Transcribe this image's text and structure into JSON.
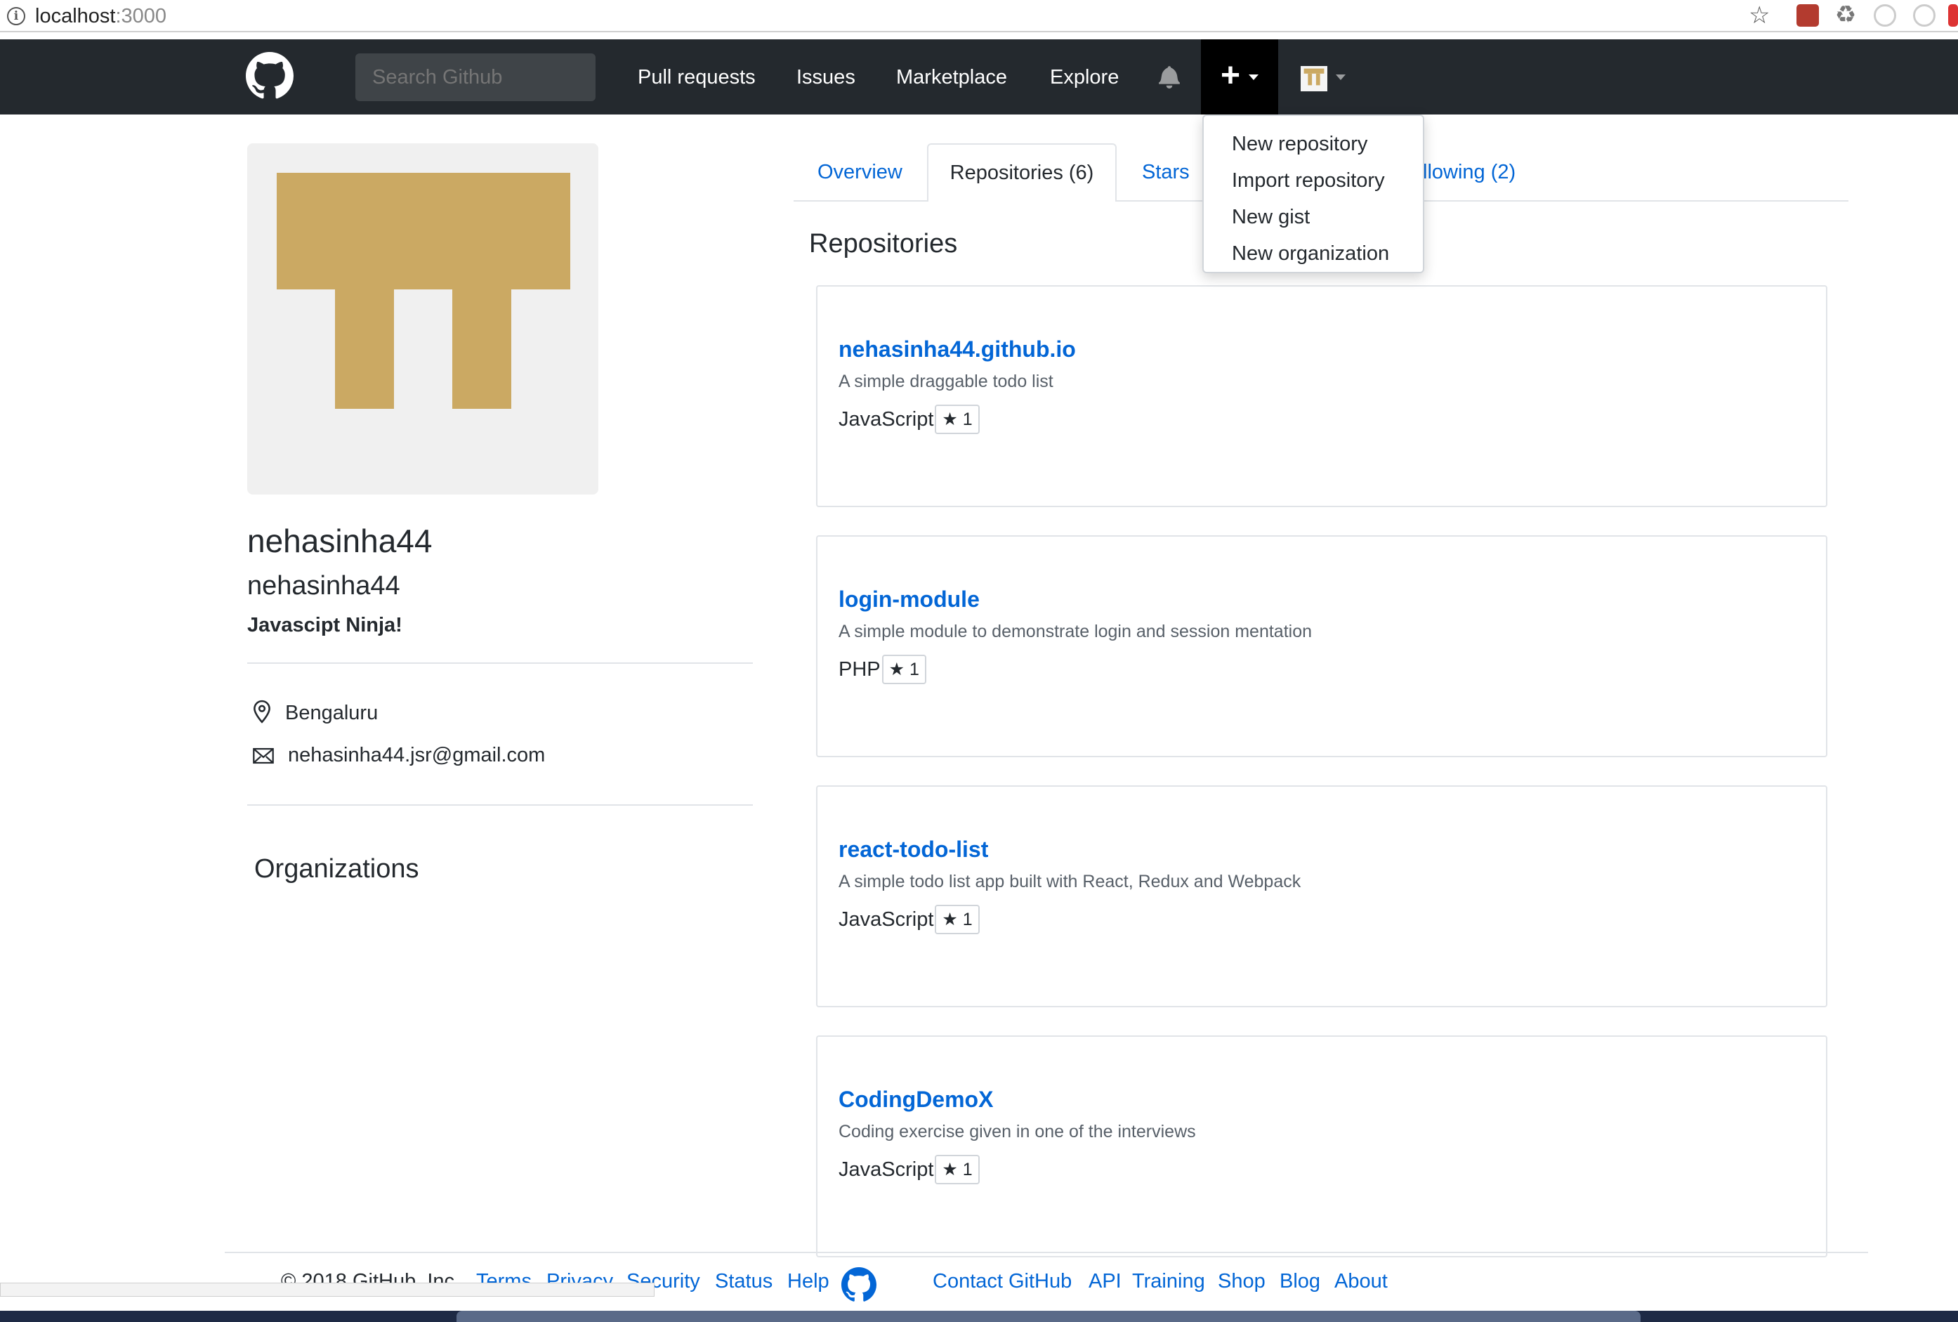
{
  "browser": {
    "url_host": "localhost",
    "url_port": ":3000"
  },
  "header": {
    "search_placeholder": "Search Github",
    "nav": [
      "Pull requests",
      "Issues",
      "Marketplace",
      "Explore"
    ],
    "plus_label": "+"
  },
  "dropdown": {
    "items": [
      "New repository",
      "Import repository",
      "New gist",
      "New organization"
    ]
  },
  "profile": {
    "name": "nehasinha44",
    "login": "nehasinha44",
    "bio": "Javascipt Ninja!",
    "location": "Bengaluru",
    "email": "nehasinha44.jsr@gmail.com",
    "organizations_title": "Organizations",
    "avatar_color": "#cba963"
  },
  "tabs": {
    "overview": "Overview",
    "repositories": "Repositories (6)",
    "stars": "Stars",
    "following": "llowing (2)"
  },
  "repositories": {
    "title": "Repositories",
    "items": [
      {
        "name": "nehasinha44.github.io",
        "description": "A simple draggable todo list",
        "language": "JavaScript",
        "stars": "★ 1"
      },
      {
        "name": "login-module",
        "description": "A simple module to demonstrate login and session mentation",
        "language": "PHP",
        "stars": "★ 1"
      },
      {
        "name": "react-todo-list",
        "description": "A simple todo list app built with React, Redux and Webpack",
        "language": "JavaScript",
        "stars": "★ 1"
      },
      {
        "name": "CodingDemoX",
        "description": "Coding exercise given in one of the interviews",
        "language": "JavaScript",
        "stars": "★ 1"
      }
    ]
  },
  "footer": {
    "copyright": "© 2018 GitHub, Inc.",
    "left_links": [
      "Terms",
      "Privacy",
      "Security",
      "Status",
      "Help"
    ],
    "right_links": [
      "Contact GitHub",
      "API",
      "Training",
      "Shop",
      "Blog",
      "About"
    ]
  },
  "colors": {
    "header_bg": "#24292e",
    "link": "#0366d6",
    "accent_gold": "#cba963"
  }
}
